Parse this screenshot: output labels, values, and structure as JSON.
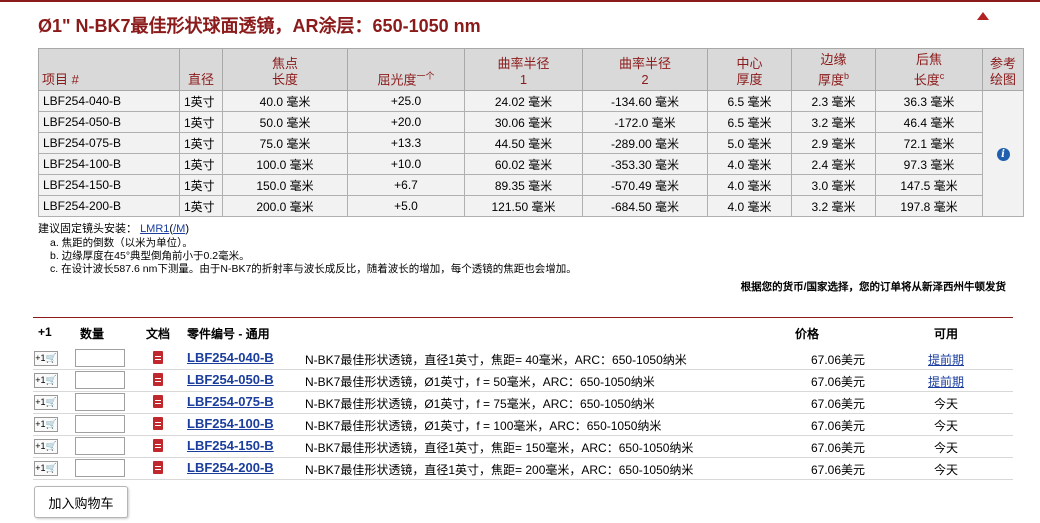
{
  "title": "Ø1\" N-BK7最佳形状球面透镜，AR涂层：650-1050 nm",
  "spec_table": {
    "headers": {
      "item": "项目 #",
      "diameter": "直径",
      "focal_1": "焦点",
      "focal_2": "长度",
      "power": "屈光度",
      "power_sup": "一个",
      "r1_1": "曲率半径",
      "r1_2": "1",
      "r2_1": "曲率半径",
      "r2_2": "2",
      "ct_1": "中心",
      "ct_2": "厚度",
      "et_1": "边缘",
      "et_2": "厚度",
      "et_sup": "b",
      "bfl_1": "后焦",
      "bfl_2": "长度",
      "bfl_sup": "c",
      "ref_1": "参考",
      "ref_2": "绘图"
    },
    "rows": [
      {
        "item": "LBF254-040-B",
        "diameter": "1英寸",
        "focal": "40.0 毫米",
        "power": "+25.0",
        "r1": "24.02 毫米",
        "r2": "-134.60 毫米",
        "ct": "6.5 毫米",
        "et": "2.3 毫米",
        "bfl": "36.3 毫米"
      },
      {
        "item": "LBF254-050-B",
        "diameter": "1英寸",
        "focal": "50.0 毫米",
        "power": "+20.0",
        "r1": "30.06 毫米",
        "r2": "-172.0 毫米",
        "ct": "6.5 毫米",
        "et": "3.2 毫米",
        "bfl": "46.4 毫米"
      },
      {
        "item": "LBF254-075-B",
        "diameter": "1英寸",
        "focal": "75.0 毫米",
        "power": "+13.3",
        "r1": "44.50 毫米",
        "r2": "-289.00 毫米",
        "ct": "5.0 毫米",
        "et": "2.9 毫米",
        "bfl": "72.1 毫米"
      },
      {
        "item": "LBF254-100-B",
        "diameter": "1英寸",
        "focal": "100.0 毫米",
        "power": "+10.0",
        "r1": "60.02 毫米",
        "r2": "-353.30 毫米",
        "ct": "4.0 毫米",
        "et": "2.4 毫米",
        "bfl": "97.3 毫米"
      },
      {
        "item": "LBF254-150-B",
        "diameter": "1英寸",
        "focal": "150.0 毫米",
        "power": "+6.7",
        "r1": "89.35 毫米",
        "r2": "-570.49 毫米",
        "ct": "4.0 毫米",
        "et": "3.0 毫米",
        "bfl": "147.5 毫米"
      },
      {
        "item": "LBF254-200-B",
        "diameter": "1英寸",
        "focal": "200.0 毫米",
        "power": "+5.0",
        "r1": "121.50 毫米",
        "r2": "-684.50 毫米",
        "ct": "4.0 毫米",
        "et": "3.2 毫米",
        "bfl": "197.8 毫米"
      }
    ],
    "info_icon": "i"
  },
  "mount": {
    "label": "建议固定镜头安装：",
    "link1": "LMR1",
    "link2": "/M"
  },
  "notes": [
    "a. 焦距的倒数（以米为单位）。",
    "b. 边缘厚度在45°典型倒角前小于0.2毫米。",
    "c. 在设计波长587.6 nm下测量。由于N-BK7的折射率与波长成反比，随着波长的增加，每个透镜的焦距也会增加。"
  ],
  "shipping": "根据您的货币/国家选择，您的订单将从新泽西州牛顿发货",
  "cart": {
    "headers": {
      "plus1": "+1",
      "qty": "数量",
      "docs": "文档",
      "part": "零件编号 - 通用",
      "price": "价格",
      "avail": "可用"
    },
    "plus1_label": "+1🛒",
    "rows": [
      {
        "part": "LBF254-040-B",
        "desc": "N-BK7最佳形状透镜，直径1英寸，焦距= 40毫米，ARC：650-1050纳米",
        "price": "67.06美元",
        "avail": "提前期",
        "avail_link": true
      },
      {
        "part": "LBF254-050-B",
        "desc": "N-BK7最佳形状透镜，Ø1英寸，f = 50毫米，ARC：650-1050纳米",
        "price": "67.06美元",
        "avail": "提前期",
        "avail_link": true
      },
      {
        "part": "LBF254-075-B",
        "desc": "N-BK7最佳形状透镜，Ø1英寸，f = 75毫米，ARC：650-1050纳米",
        "price": "67.06美元",
        "avail": "今天",
        "avail_link": false
      },
      {
        "part": "LBF254-100-B",
        "desc": "N-BK7最佳形状透镜，Ø1英寸，f = 100毫米，ARC：650-1050纳米",
        "price": "67.06美元",
        "avail": "今天",
        "avail_link": false
      },
      {
        "part": "LBF254-150-B",
        "desc": "N-BK7最佳形状透镜，直径1英寸，焦距= 150毫米，ARC：650-1050纳米",
        "price": "67.06美元",
        "avail": "今天",
        "avail_link": false
      },
      {
        "part": "LBF254-200-B",
        "desc": "N-BK7最佳形状透镜，直径1英寸，焦距= 200毫米，ARC：650-1050纳米",
        "price": "67.06美元",
        "avail": "今天",
        "avail_link": false
      }
    ],
    "add_button": "加入购物车"
  },
  "colors": {
    "brand": "#8b1a1a",
    "link": "#1a3d9e",
    "doc_icon": "#c0282d"
  }
}
